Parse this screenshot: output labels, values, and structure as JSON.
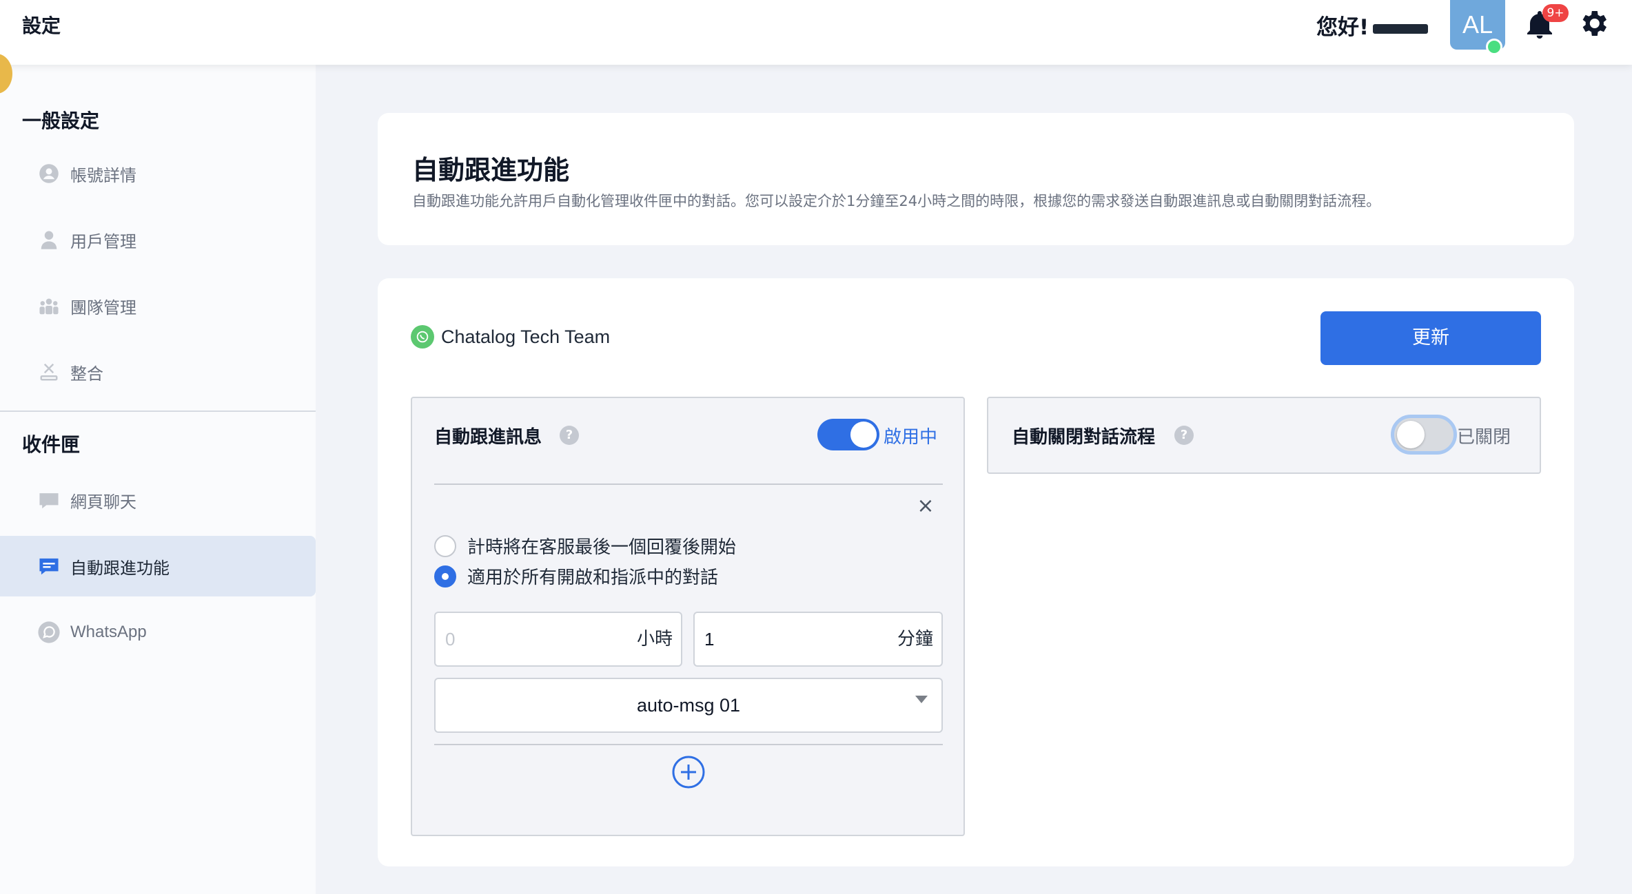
{
  "header": {
    "title": "設定",
    "greeting": "您好!",
    "avatar_initials": "AL",
    "notification_badge": "9+"
  },
  "sidebar": {
    "general_title": "一般設定",
    "general_items": [
      {
        "label": "帳號詳情",
        "icon": "user-circle-icon"
      },
      {
        "label": "用戶管理",
        "icon": "user-icon"
      },
      {
        "label": "團隊管理",
        "icon": "team-icon"
      },
      {
        "label": "整合",
        "icon": "integration-icon"
      }
    ],
    "inbox_title": "收件匣",
    "inbox_items": [
      {
        "label": "網頁聊天",
        "icon": "webchat-icon"
      },
      {
        "label": "自動跟進功能",
        "icon": "chat-message-icon",
        "active": true
      },
      {
        "label": "WhatsApp",
        "icon": "whatsapp-icon"
      }
    ]
  },
  "main": {
    "heading": "自動跟進功能",
    "description": "自動跟進功能允許用戶自動化管理收件匣中的對話。您可以設定介於1分鐘至24小時之間的時限，根據您的需求發送自動跟進訊息或自動關閉對話流程。",
    "channel_name": "Chatalog Tech Team",
    "update_button": "更新",
    "followup": {
      "title": "自動跟進訊息",
      "help": "?",
      "toggle_state": "啟用中",
      "enabled": true,
      "close_symbol": "×",
      "options": [
        {
          "label": "計時將在客服最後一個回覆後開始",
          "checked": false
        },
        {
          "label": "適用於所有開啟和指派中的對話",
          "checked": true
        }
      ],
      "hours_placeholder": "0",
      "hours_unit": "小時",
      "minutes_value": "1",
      "minutes_unit": "分鐘",
      "message_template": "auto-msg 01"
    },
    "autoclose": {
      "title": "自動關閉對話流程",
      "help": "?",
      "toggle_state": "已關閉",
      "enabled": false
    }
  },
  "colors": {
    "primary": "#2f6fe4",
    "badge": "#ef4444",
    "avatar": "#6fa8dc",
    "online": "#4ade80",
    "whatsapp": "#5cc870"
  }
}
